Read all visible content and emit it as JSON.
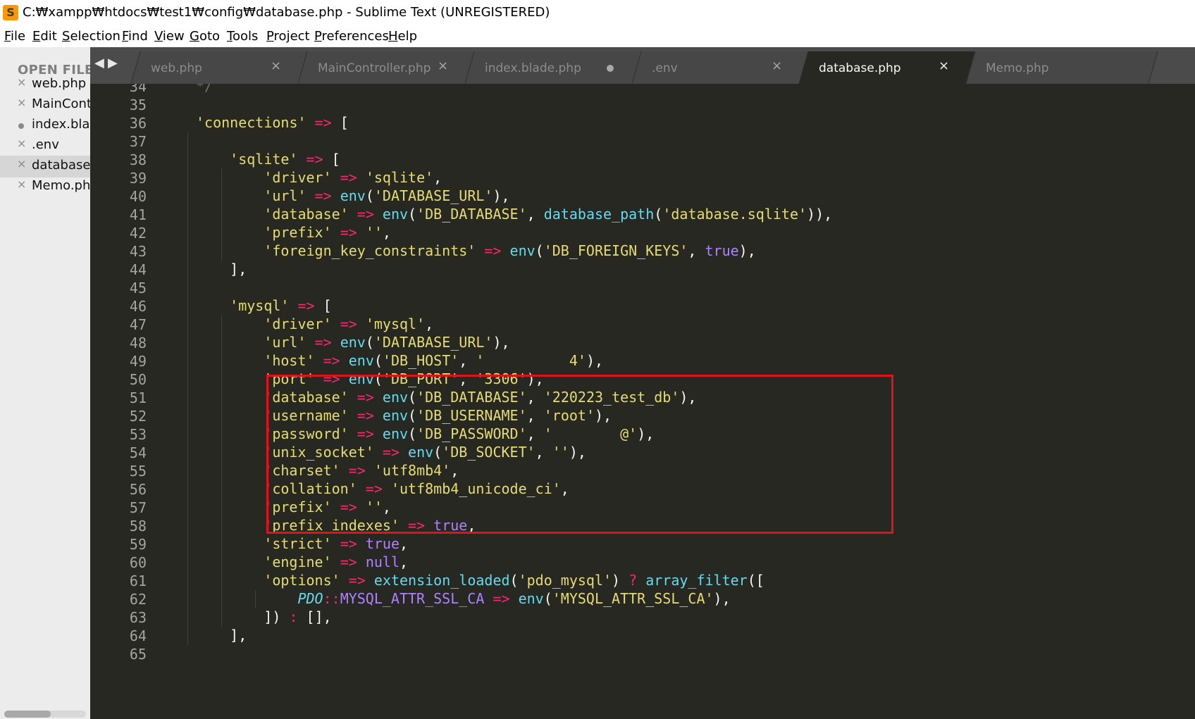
{
  "window": {
    "title": "C:₩xampp₩htdocs₩test1₩config₩database.php - Sublime Text (UNREGISTERED)",
    "app_icon": "sublime-logo-icon"
  },
  "menu": [
    {
      "label": "File"
    },
    {
      "label": "Edit"
    },
    {
      "label": "Selection"
    },
    {
      "label": "Find"
    },
    {
      "label": "View"
    },
    {
      "label": "Goto"
    },
    {
      "label": "Tools"
    },
    {
      "label": "Project"
    },
    {
      "label": "Preferences"
    },
    {
      "label": "Help"
    }
  ],
  "sidebar": {
    "header": "OPEN FILES",
    "files": [
      {
        "name": "web.php",
        "state": "close"
      },
      {
        "name": "MainController.php",
        "state": "close"
      },
      {
        "name": "index.blade.php",
        "state": "dirty"
      },
      {
        "name": ".env",
        "state": "close"
      },
      {
        "name": "database.php",
        "state": "close",
        "active": true
      },
      {
        "name": "Memo.php",
        "state": "close"
      }
    ]
  },
  "tabs": [
    {
      "label": "web.php",
      "state": "close"
    },
    {
      "label": "MainController.php",
      "state": "close"
    },
    {
      "label": "index.blade.php",
      "state": "dirty"
    },
    {
      "label": ".env",
      "state": "close"
    },
    {
      "label": "database.php",
      "state": "close",
      "active": true
    },
    {
      "label": "Memo.php",
      "state": "none"
    }
  ],
  "tab_nav": {
    "left": "◀",
    "right": "▶"
  },
  "close_glyph": "×",
  "colors": {
    "editor_bg": "#272822",
    "string": "#e6db74",
    "keyword": "#f92672",
    "function": "#66d9ef",
    "constant": "#ae81ff",
    "highlight_box": "#e0131a"
  },
  "editor": {
    "first_line": 34,
    "lines": [
      {
        "n": "34",
        "indent": 4,
        "tokens": [
          [
            "cm",
            "*/"
          ]
        ]
      },
      {
        "n": "35",
        "indent": 0,
        "tokens": []
      },
      {
        "n": "36",
        "indent": 4,
        "tokens": [
          [
            "s",
            "'connections'"
          ],
          [
            "g",
            " "
          ],
          [
            "k",
            "=>"
          ],
          [
            "g",
            " ["
          ]
        ]
      },
      {
        "n": "37",
        "indent": 0,
        "tokens": []
      },
      {
        "n": "38",
        "indent": 8,
        "tokens": [
          [
            "s",
            "'sqlite'"
          ],
          [
            "g",
            " "
          ],
          [
            "k",
            "=>"
          ],
          [
            "g",
            " ["
          ]
        ]
      },
      {
        "n": "39",
        "indent": 12,
        "tokens": [
          [
            "s",
            "'driver'"
          ],
          [
            "g",
            " "
          ],
          [
            "k",
            "=>"
          ],
          [
            "g",
            " "
          ],
          [
            "s",
            "'sqlite'"
          ],
          [
            "g",
            ","
          ]
        ]
      },
      {
        "n": "40",
        "indent": 12,
        "tokens": [
          [
            "s",
            "'url'"
          ],
          [
            "g",
            " "
          ],
          [
            "k",
            "=>"
          ],
          [
            "g",
            " "
          ],
          [
            "f",
            "env"
          ],
          [
            "g",
            "("
          ],
          [
            "s",
            "'DATABASE_URL'"
          ],
          [
            "g",
            "),"
          ]
        ]
      },
      {
        "n": "41",
        "indent": 12,
        "tokens": [
          [
            "s",
            "'database'"
          ],
          [
            "g",
            " "
          ],
          [
            "k",
            "=>"
          ],
          [
            "g",
            " "
          ],
          [
            "f",
            "env"
          ],
          [
            "g",
            "("
          ],
          [
            "s",
            "'DB_DATABASE'"
          ],
          [
            "g",
            ", "
          ],
          [
            "f",
            "database_path"
          ],
          [
            "g",
            "("
          ],
          [
            "s",
            "'database.sqlite'"
          ],
          [
            "g",
            ")),"
          ]
        ]
      },
      {
        "n": "42",
        "indent": 12,
        "tokens": [
          [
            "s",
            "'prefix'"
          ],
          [
            "g",
            " "
          ],
          [
            "k",
            "=>"
          ],
          [
            "g",
            " "
          ],
          [
            "s",
            "''"
          ],
          [
            "g",
            ","
          ]
        ]
      },
      {
        "n": "43",
        "indent": 12,
        "tokens": [
          [
            "s",
            "'foreign_key_constraints'"
          ],
          [
            "g",
            " "
          ],
          [
            "k",
            "=>"
          ],
          [
            "g",
            " "
          ],
          [
            "f",
            "env"
          ],
          [
            "g",
            "("
          ],
          [
            "s",
            "'DB_FOREIGN_KEYS'"
          ],
          [
            "g",
            ", "
          ],
          [
            "c",
            "true"
          ],
          [
            "g",
            "),"
          ]
        ]
      },
      {
        "n": "44",
        "indent": 8,
        "tokens": [
          [
            "g",
            "],"
          ]
        ]
      },
      {
        "n": "45",
        "indent": 0,
        "tokens": []
      },
      {
        "n": "46",
        "indent": 8,
        "tokens": [
          [
            "s",
            "'mysql'"
          ],
          [
            "g",
            " "
          ],
          [
            "k",
            "=>"
          ],
          [
            "g",
            " ["
          ]
        ]
      },
      {
        "n": "47",
        "indent": 12,
        "tokens": [
          [
            "s",
            "'driver'"
          ],
          [
            "g",
            " "
          ],
          [
            "k",
            "=>"
          ],
          [
            "g",
            " "
          ],
          [
            "s",
            "'mysql'"
          ],
          [
            "g",
            ","
          ]
        ]
      },
      {
        "n": "48",
        "indent": 12,
        "tokens": [
          [
            "s",
            "'url'"
          ],
          [
            "g",
            " "
          ],
          [
            "k",
            "=>"
          ],
          [
            "g",
            " "
          ],
          [
            "f",
            "env"
          ],
          [
            "g",
            "("
          ],
          [
            "s",
            "'DATABASE_URL'"
          ],
          [
            "g",
            "),"
          ]
        ]
      },
      {
        "n": "49",
        "indent": 12,
        "tokens": [
          [
            "s",
            "'host'"
          ],
          [
            "g",
            " "
          ],
          [
            "k",
            "=>"
          ],
          [
            "g",
            " "
          ],
          [
            "f",
            "env"
          ],
          [
            "g",
            "("
          ],
          [
            "s",
            "'DB_HOST'"
          ],
          [
            "g",
            ", "
          ],
          [
            "s",
            "'          4'"
          ],
          [
            "g",
            "),"
          ]
        ]
      },
      {
        "n": "50",
        "indent": 12,
        "tokens": [
          [
            "s",
            "'port'"
          ],
          [
            "g",
            " "
          ],
          [
            "k",
            "=>"
          ],
          [
            "g",
            " "
          ],
          [
            "f",
            "env"
          ],
          [
            "g",
            "("
          ],
          [
            "s",
            "'DB_PORT'"
          ],
          [
            "g",
            ", "
          ],
          [
            "s",
            "'3306'"
          ],
          [
            "g",
            "),"
          ]
        ]
      },
      {
        "n": "51",
        "indent": 12,
        "tokens": [
          [
            "s",
            "'database'"
          ],
          [
            "g",
            " "
          ],
          [
            "k",
            "=>"
          ],
          [
            "g",
            " "
          ],
          [
            "f",
            "env"
          ],
          [
            "g",
            "("
          ],
          [
            "s",
            "'DB_DATABASE'"
          ],
          [
            "g",
            ", "
          ],
          [
            "s",
            "'220223_test_db'"
          ],
          [
            "g",
            "),"
          ]
        ]
      },
      {
        "n": "52",
        "indent": 12,
        "tokens": [
          [
            "s",
            "'username'"
          ],
          [
            "g",
            " "
          ],
          [
            "k",
            "=>"
          ],
          [
            "g",
            " "
          ],
          [
            "f",
            "env"
          ],
          [
            "g",
            "("
          ],
          [
            "s",
            "'DB_USERNAME'"
          ],
          [
            "g",
            ", "
          ],
          [
            "s",
            "'root'"
          ],
          [
            "g",
            "),"
          ]
        ]
      },
      {
        "n": "53",
        "indent": 12,
        "tokens": [
          [
            "s",
            "'password'"
          ],
          [
            "g",
            " "
          ],
          [
            "k",
            "=>"
          ],
          [
            "g",
            " "
          ],
          [
            "f",
            "env"
          ],
          [
            "g",
            "("
          ],
          [
            "s",
            "'DB_PASSWORD'"
          ],
          [
            "g",
            ", "
          ],
          [
            "s",
            "'        @'"
          ],
          [
            "g",
            "),"
          ]
        ]
      },
      {
        "n": "54",
        "indent": 12,
        "tokens": [
          [
            "s",
            "'unix_socket'"
          ],
          [
            "g",
            " "
          ],
          [
            "k",
            "=>"
          ],
          [
            "g",
            " "
          ],
          [
            "f",
            "env"
          ],
          [
            "g",
            "("
          ],
          [
            "s",
            "'DB_SOCKET'"
          ],
          [
            "g",
            ", "
          ],
          [
            "s",
            "''"
          ],
          [
            "g",
            "),"
          ]
        ]
      },
      {
        "n": "55",
        "indent": 12,
        "tokens": [
          [
            "s",
            "'charset'"
          ],
          [
            "g",
            " "
          ],
          [
            "k",
            "=>"
          ],
          [
            "g",
            " "
          ],
          [
            "s",
            "'utf8mb4'"
          ],
          [
            "g",
            ","
          ]
        ]
      },
      {
        "n": "56",
        "indent": 12,
        "tokens": [
          [
            "s",
            "'collation'"
          ],
          [
            "g",
            " "
          ],
          [
            "k",
            "=>"
          ],
          [
            "g",
            " "
          ],
          [
            "s",
            "'utf8mb4_unicode_ci'"
          ],
          [
            "g",
            ","
          ]
        ]
      },
      {
        "n": "57",
        "indent": 12,
        "tokens": [
          [
            "s",
            "'prefix'"
          ],
          [
            "g",
            " "
          ],
          [
            "k",
            "=>"
          ],
          [
            "g",
            " "
          ],
          [
            "s",
            "''"
          ],
          [
            "g",
            ","
          ]
        ]
      },
      {
        "n": "58",
        "indent": 12,
        "tokens": [
          [
            "s",
            "'prefix_indexes'"
          ],
          [
            "g",
            " "
          ],
          [
            "k",
            "=>"
          ],
          [
            "g",
            " "
          ],
          [
            "c",
            "true"
          ],
          [
            "g",
            ","
          ]
        ]
      },
      {
        "n": "59",
        "indent": 12,
        "tokens": [
          [
            "s",
            "'strict'"
          ],
          [
            "g",
            " "
          ],
          [
            "k",
            "=>"
          ],
          [
            "g",
            " "
          ],
          [
            "c",
            "true"
          ],
          [
            "g",
            ","
          ]
        ]
      },
      {
        "n": "60",
        "indent": 12,
        "tokens": [
          [
            "s",
            "'engine'"
          ],
          [
            "g",
            " "
          ],
          [
            "k",
            "=>"
          ],
          [
            "g",
            " "
          ],
          [
            "c",
            "null"
          ],
          [
            "g",
            ","
          ]
        ]
      },
      {
        "n": "61",
        "indent": 12,
        "tokens": [
          [
            "s",
            "'options'"
          ],
          [
            "g",
            " "
          ],
          [
            "k",
            "=>"
          ],
          [
            "g",
            " "
          ],
          [
            "f",
            "extension_loaded"
          ],
          [
            "g",
            "("
          ],
          [
            "s",
            "'pdo_mysql'"
          ],
          [
            "g",
            ") "
          ],
          [
            "k",
            "?"
          ],
          [
            "g",
            " "
          ],
          [
            "f",
            "array_filter"
          ],
          [
            "g",
            "(["
          ]
        ]
      },
      {
        "n": "62",
        "indent": 16,
        "tokens": [
          [
            "i",
            "PDO"
          ],
          [
            "k",
            "::"
          ],
          [
            "c",
            "MYSQL_ATTR_SSL_CA"
          ],
          [
            "g",
            " "
          ],
          [
            "k",
            "=>"
          ],
          [
            "g",
            " "
          ],
          [
            "f",
            "env"
          ],
          [
            "g",
            "("
          ],
          [
            "s",
            "'MYSQL_ATTR_SSL_CA'"
          ],
          [
            "g",
            "),"
          ]
        ]
      },
      {
        "n": "63",
        "indent": 12,
        "tokens": [
          [
            "g",
            "]) "
          ],
          [
            "k",
            ":"
          ],
          [
            "g",
            " [],"
          ]
        ]
      },
      {
        "n": "64",
        "indent": 8,
        "tokens": [
          [
            "g",
            "],"
          ]
        ]
      },
      {
        "n": "65",
        "indent": 0,
        "tokens": []
      }
    ]
  }
}
